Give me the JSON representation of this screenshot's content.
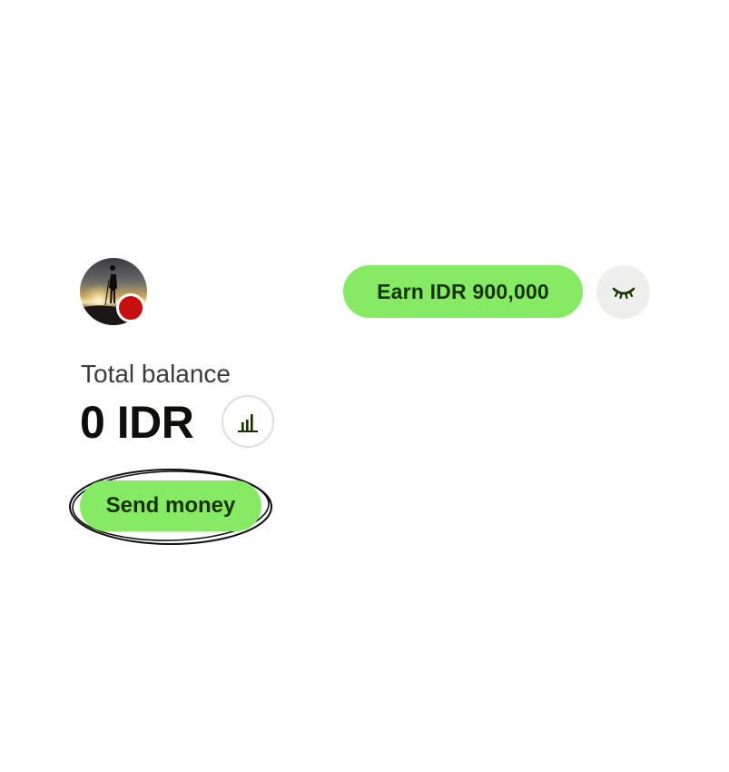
{
  "profile": {
    "avatar_icon": "user-photo-silhouette",
    "badge_color": "#c70f0f"
  },
  "header": {
    "earn_label": "Earn IDR 900,000",
    "earn_color": "#86ea64",
    "eye_icon": "eye-closed-icon"
  },
  "balance": {
    "label": "Total balance",
    "amount": "0 IDR",
    "insights_icon": "bar-chart-icon"
  },
  "actions": {
    "send_money_label": "Send money",
    "accent_color": "#86ea64",
    "text_color": "#163300"
  }
}
